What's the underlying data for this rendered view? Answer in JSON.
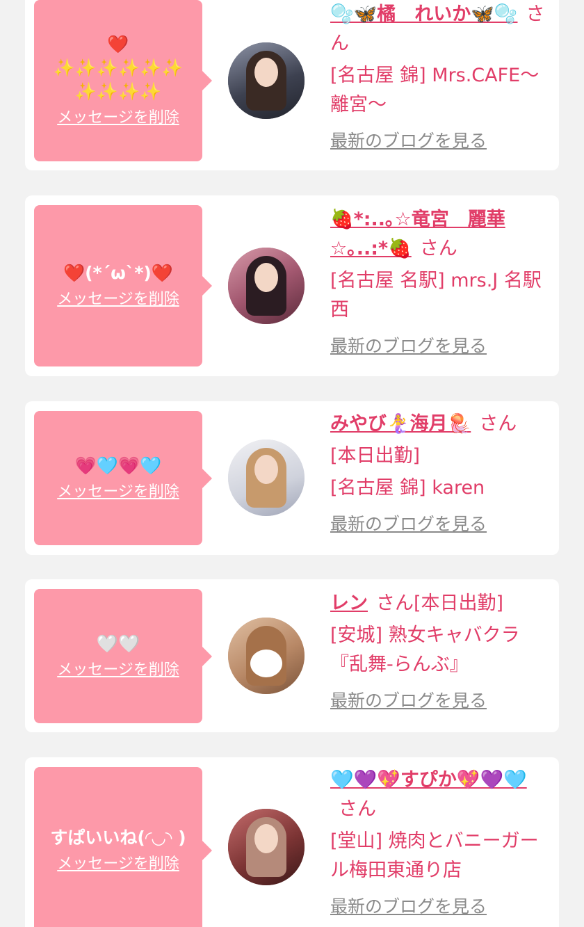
{
  "colors": {
    "background": "#f2f2f2",
    "card": "#ffffff",
    "bubble": "#fd99a9",
    "accent": "#e13d68",
    "muted": "#8a8a8a"
  },
  "cards": [
    {
      "message": "❤️\n✨✨✨✨✨✨\n✨✨✨✨",
      "delete_label": "メッセージを削除",
      "name": "🫧🦋橘　れいか🦋🫧",
      "san": "さん",
      "shop": "[名古屋 錦] Mrs.CAFE～離宮～",
      "blog_label": "最新のブログを見る",
      "avatar": "avatar-photo"
    },
    {
      "message": "❤️(*´ω`*)❤️",
      "delete_label": "メッセージを削除",
      "name": "🍓*:..｡☆竜宮　麗華☆｡..:*🍓",
      "san": "さん",
      "shop": "[名古屋 名駅] mrs.J 名駅西",
      "blog_label": "最新のブログを見る",
      "avatar": "avatar-photo"
    },
    {
      "message": "💗🩵💗🩵",
      "delete_label": "メッセージを削除",
      "name": "みやび🧜‍♀️海月🪼",
      "san": "さん",
      "status": "[本日出勤]",
      "shop": "[名古屋 錦] karen",
      "blog_label": "最新のブログを見る",
      "avatar": "avatar-photo"
    },
    {
      "message": "🤍🤍",
      "delete_label": "メッセージを削除",
      "name": "レン",
      "san": "さん[本日出勤]",
      "shop": "[安城] 熟女キャバクラ『乱舞-らんぶ』",
      "blog_label": "最新のブログを見る",
      "avatar": "avatar-photo"
    },
    {
      "message": "すぱいいね(◜◡◝ )",
      "delete_label": "メッセージを削除",
      "name": "🩵💜💖すぴか💖💜🩵",
      "san": "さん",
      "shop": "[堂山] 焼肉とバニーガール梅田東通り店",
      "blog_label": "最新のブログを見る",
      "avatar": "avatar-photo"
    }
  ]
}
